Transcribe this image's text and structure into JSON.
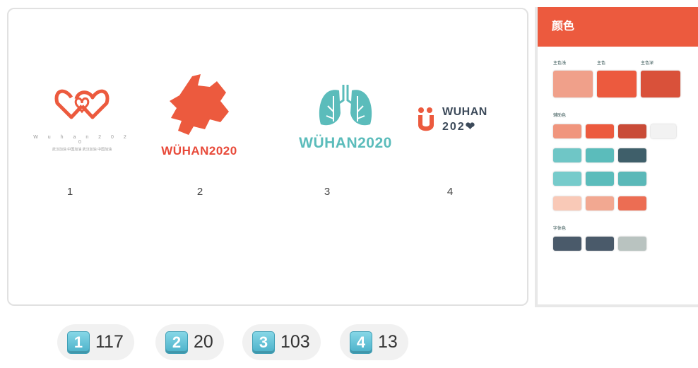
{
  "logos": [
    {
      "number": "1",
      "subtitle_latin": "W u h a n 2 0 2 0",
      "subtitle_cn": "武汉加油 中国加油 武汉加油 中国加油"
    },
    {
      "number": "2",
      "wordmark": "WÜHAN2020"
    },
    {
      "number": "3",
      "wordmark": "WÜHAN2020"
    },
    {
      "number": "4",
      "wordmark_line1": "WUHAN",
      "wordmark_line2": "202❤"
    }
  ],
  "palette": {
    "title": "颜色",
    "primary_labels": [
      "主色浅",
      "主色",
      "主色深"
    ],
    "secondary_label": "辅助色",
    "text_label": "字体色",
    "colors": {
      "primary": [
        "#f0a08a",
        "#ec5a3e",
        "#d9513a"
      ],
      "secondary_rows": [
        [
          "#f0957d",
          "#ec5a3e",
          "#c94b37",
          "#f2f2f2"
        ],
        [
          "#6fc6c6",
          "#5bbcbb",
          "#3f5f6a"
        ],
        [
          "#76cbcb",
          "#5bbcbb",
          "#5ab8b8"
        ],
        [
          "#f9c9b7",
          "#f2a891",
          "#ec6d53"
        ]
      ],
      "text": [
        "#4a5a6a",
        "#4a5a6a",
        "#b9c3c0"
      ]
    }
  },
  "reactions": [
    {
      "key": "1",
      "count": "117"
    },
    {
      "key": "2",
      "count": "20"
    },
    {
      "key": "3",
      "count": "103"
    },
    {
      "key": "4",
      "count": "13"
    }
  ],
  "accent": {
    "coral": "#ec5a3e",
    "teal": "#5bbcbb",
    "navy": "#3c4a5a"
  }
}
